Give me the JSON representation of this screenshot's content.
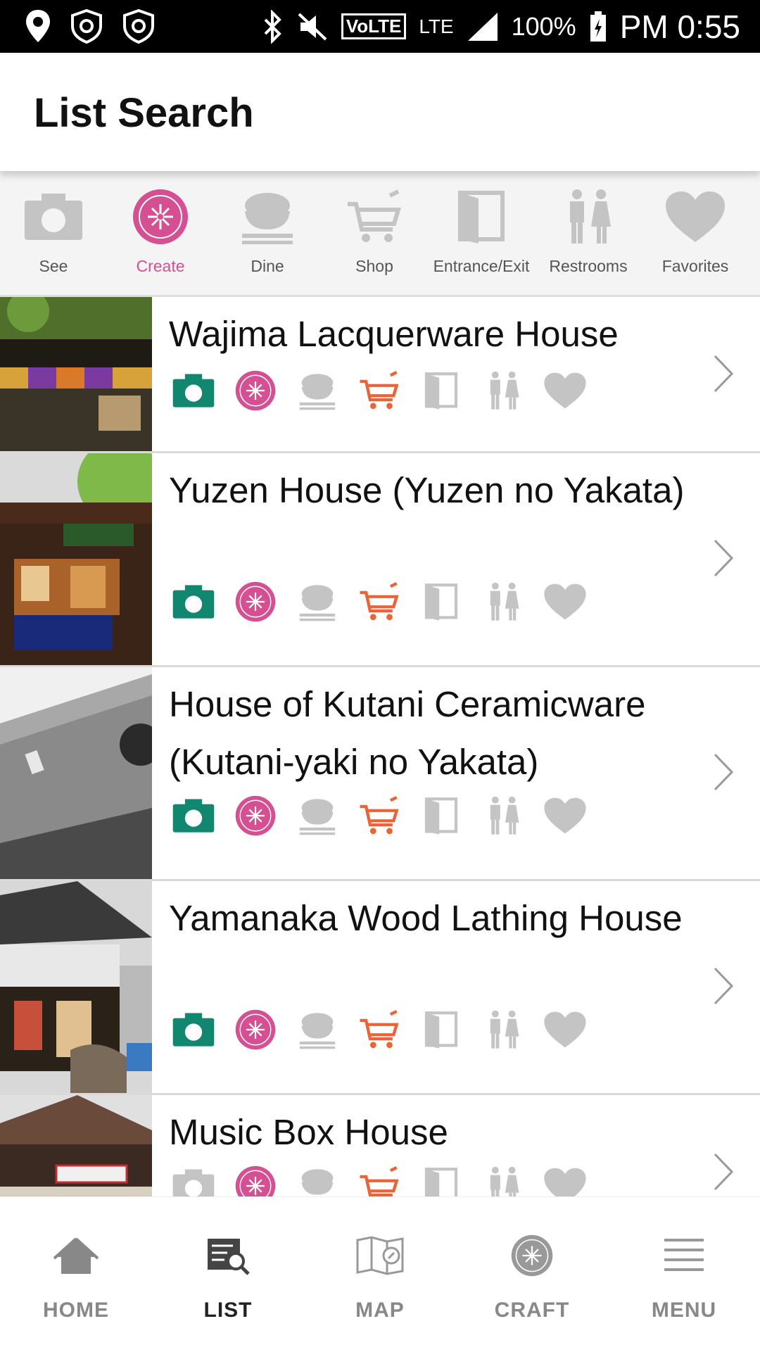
{
  "status_bar": {
    "volte": "VoLTE",
    "lte": "LTE",
    "battery": "100%",
    "time": "PM 0:55"
  },
  "header": {
    "title": "List Search"
  },
  "filters": [
    {
      "label": "See",
      "icon": "camera-icon"
    },
    {
      "label": "Create",
      "icon": "craft-flower-icon",
      "selected": true
    },
    {
      "label": "Dine",
      "icon": "rice-bowl-icon"
    },
    {
      "label": "Shop",
      "icon": "shopping-cart-icon"
    },
    {
      "label": "Entrance/Exit",
      "icon": "door-icon"
    },
    {
      "label": "Restrooms",
      "icon": "restroom-icon"
    },
    {
      "label": "Favorites",
      "icon": "heart-icon"
    }
  ],
  "colors": {
    "see": "#11876f",
    "create": "#d45092",
    "shop": "#e8653a",
    "inactive": "#c4c4c4"
  },
  "places": [
    {
      "name": "Wajima Lacquerware House",
      "photo": "wajima-lacquerware-house-photo",
      "categories": [
        "see",
        "create",
        "shop"
      ]
    },
    {
      "name": "Yuzen House (Yuzen no Yakata)",
      "photo": "yuzen-house-photo",
      "categories": [
        "see",
        "create",
        "shop"
      ]
    },
    {
      "name": "House of Kutani Ceramicware (Kutani-yaki no Yakata)",
      "photo": "kutani-house-photo",
      "categories": [
        "see",
        "create",
        "shop"
      ]
    },
    {
      "name": "Yamanaka Wood Lathing House",
      "photo": "yamanaka-house-photo",
      "categories": [
        "see",
        "create",
        "shop"
      ]
    },
    {
      "name": "Music Box House",
      "photo": "music-box-house-photo",
      "categories": [
        "create",
        "shop"
      ]
    }
  ],
  "bottom_nav": [
    {
      "label": "HOME",
      "icon": "home-icon"
    },
    {
      "label": "LIST",
      "icon": "list-search-icon",
      "selected": true
    },
    {
      "label": "MAP",
      "icon": "map-icon"
    },
    {
      "label": "CRAFT",
      "icon": "craft-icon"
    },
    {
      "label": "MENU",
      "icon": "hamburger-menu-icon"
    }
  ]
}
